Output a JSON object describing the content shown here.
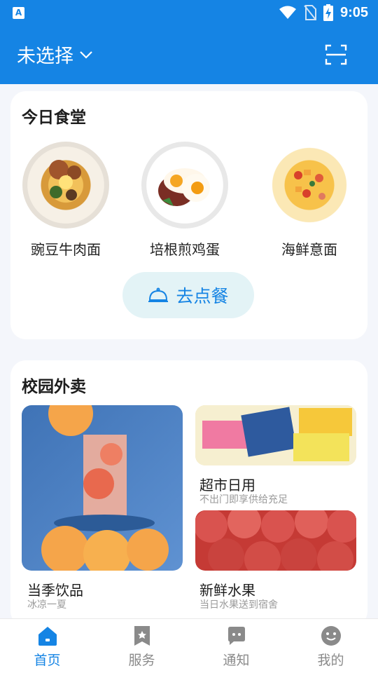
{
  "status_bar": {
    "app_badge": "A",
    "time": "9:05",
    "icons": [
      "wifi-icon",
      "no-sim-icon",
      "battery-charging-icon"
    ]
  },
  "header": {
    "location_label": "未选择",
    "dropdown_icon": "chevron-down-icon",
    "scan_icon": "scan-icon"
  },
  "canteen": {
    "title": "今日食堂",
    "dishes": [
      {
        "name": "豌豆牛肉面"
      },
      {
        "name": "培根煎鸡蛋"
      },
      {
        "name": "海鲜意面"
      }
    ],
    "order_button_label": "去点餐",
    "order_button_icon": "food-cloche-icon"
  },
  "takeout": {
    "title": "校园外卖",
    "tiles": [
      {
        "title": "当季饮品",
        "subtitle": "冰凉一夏"
      },
      {
        "title": "超市日用",
        "subtitle": "不出门即享供给充足"
      },
      {
        "title": "新鲜水果",
        "subtitle": "当日水果送到宿舍"
      }
    ]
  },
  "bottom_nav": {
    "items": [
      {
        "label": "首页",
        "icon": "home-icon",
        "active": true
      },
      {
        "label": "服务",
        "icon": "bookmark-star-icon",
        "active": false
      },
      {
        "label": "通知",
        "icon": "message-icon",
        "active": false
      },
      {
        "label": "我的",
        "icon": "smiley-icon",
        "active": false
      }
    ]
  },
  "colors": {
    "primary": "#1584e4",
    "background": "#f4f6fb",
    "order_button_bg": "#e3f3f6",
    "inactive_nav": "#8a8a8a"
  }
}
